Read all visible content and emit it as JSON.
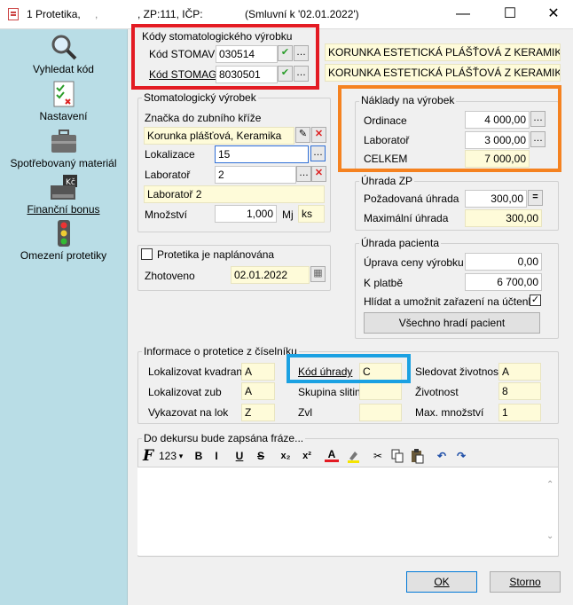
{
  "window": {
    "title_prefix": "1 Protetika,",
    "title_dot": ",",
    "title_mid": ", ZP:111, IČP:",
    "title_contract": "(Smluvní k '02.01.2022')",
    "minimize": "—",
    "maximize": "☐",
    "close": "✕"
  },
  "sidebar": {
    "items": [
      {
        "label": "Vyhledat kód",
        "icon": "magnifier-icon"
      },
      {
        "label": "Nastavení",
        "icon": "checklist-icon"
      },
      {
        "label": "Spotřebovaný materiál",
        "icon": "briefcase-icon"
      },
      {
        "label": "Finanční bonus",
        "icon": "cash-register-icon"
      },
      {
        "label": "Omezení protetiky",
        "icon": "traffic-light-icon"
      }
    ]
  },
  "codes": {
    "title": "Kódy stomatologického výrobku",
    "stomav_label": "Kód STOMAV",
    "stomav_value": "030514",
    "stomag_label": "Kód STOMAG",
    "stomag_value": "8030501",
    "stomav_desc": "KORUNKA ESTETICKÁ PLÁŠŤOVÁ Z KERAMIKY -...",
    "stomag_desc": "KORUNKA ESTETICKÁ PLÁŠŤOVÁ Z KERAMIKY"
  },
  "product": {
    "title": "Stomatologický výrobek",
    "brand_label": "Značka do zubního kříže",
    "brand_value": "Korunka plášťová, Keramika",
    "loc_label": "Lokalizace",
    "loc_value": "15",
    "lab_label": "Laboratoř",
    "lab_value": "2",
    "lab_name": "Laboratoř 2",
    "qty_label": "Množství",
    "qty_value": "1,000",
    "unit_label": "Mj",
    "unit_value": "ks"
  },
  "costs": {
    "title": "Náklady na výrobek",
    "ordinace_label": "Ordinace",
    "ordinace_value": "4 000,00",
    "lab_label": "Laboratoř",
    "lab_value": "3 000,00",
    "total_label": "CELKEM",
    "total_value": "7 000,00"
  },
  "zp": {
    "title": "Úhrada ZP",
    "req_label": "Požadovaná úhrada",
    "req_value": "300,00",
    "max_label": "Maximální úhrada",
    "max_value": "300,00"
  },
  "patient": {
    "title": "Úhrada pacienta",
    "adj_label": "Úprava ceny výrobku",
    "adj_value": "0,00",
    "pay_label": "K platbě",
    "pay_value": "6 700,00",
    "check_label": "Hlídat a umožnit zařazení na účtenku",
    "check_mark": "✓",
    "all_button": "Všechno hradí pacient"
  },
  "planned": {
    "label": "Protetika je naplánována",
    "done_label": "Zhotoveno",
    "done_value": "02.01.2022"
  },
  "info": {
    "title": "Informace o protetice z číselníku",
    "kvadrant_label": "Lokalizovat kvadrant",
    "kvadrant_value": "A",
    "zub_label": "Lokalizovat zub",
    "zub_value": "A",
    "lok_label": "Vykazovat na lok",
    "lok_value": "Z",
    "uhrada_label": "Kód úhrady",
    "uhrada_value": "C",
    "slitin_label": "Skupina slitin",
    "slitin_value": "",
    "zvl_label": "Zvl",
    "zvl_value": "",
    "zivot_label": "Sledovat životnost",
    "zivot_value": "A",
    "zivotnost_label": "Životnost",
    "zivotnost_value": "8",
    "max_label": "Max. množství",
    "max_value": "1"
  },
  "editor": {
    "title": "Do dekursu bude zapsána fráze...",
    "font": "F",
    "size": "123",
    "bold": "B",
    "italic": "I",
    "underline": "U",
    "strike": "S",
    "sub": "x₂",
    "sup": "x²",
    "color": "A",
    "text": ""
  },
  "footer": {
    "ok": "OK",
    "cancel": "Storno"
  },
  "colors": {
    "sidebar": "#b9dde6",
    "highlight_red": "#e31b23",
    "highlight_orange": "#f58220",
    "highlight_blue": "#1ba1e2",
    "yellow_field": "#fefbd9"
  }
}
